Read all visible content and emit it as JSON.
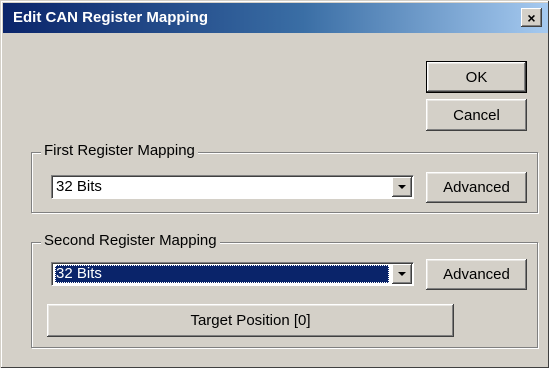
{
  "window": {
    "title": "Edit CAN Register Mapping",
    "close_label": "×"
  },
  "buttons": {
    "ok": "OK",
    "cancel": "Cancel"
  },
  "first_mapping": {
    "label": "First Register Mapping",
    "selected_value": "32 Bits",
    "advanced_label": "Advanced"
  },
  "second_mapping": {
    "label": "Second Register Mapping",
    "selected_value": "32 Bits",
    "advanced_label": "Advanced",
    "target_position_label": "Target Position [0]"
  },
  "colors": {
    "title_bar": "#0a246a",
    "dialog_face": "#d4d0c8",
    "selection": "#0a246a"
  }
}
